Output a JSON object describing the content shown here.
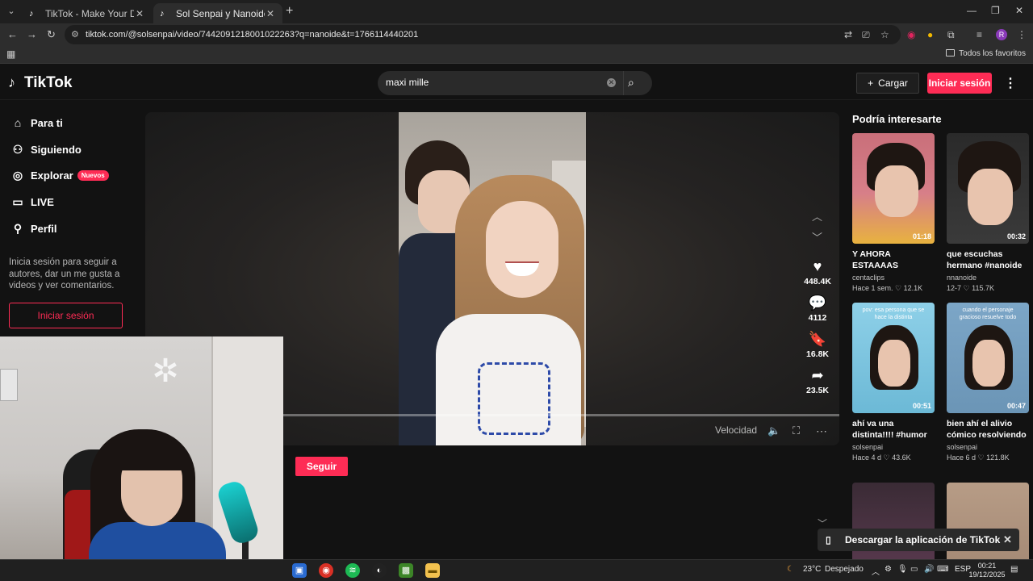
{
  "browser": {
    "tabs": [
      {
        "title": "TikTok - Make Your Day",
        "active": false
      },
      {
        "title": "Sol Senpai y Nanoide: Tutorial",
        "active": true
      }
    ],
    "url": "tiktok.com/@solsenpai/video/7442091218001022263?q=nanoide&t=1766114440201",
    "bookmarks_all": "Todos los favoritos",
    "profile_initial": "R"
  },
  "tiktok": {
    "logo": "TikTok",
    "search": {
      "value": "maxi mille"
    },
    "upload_label": "Cargar",
    "login_label": "Iniciar sesión",
    "nav": [
      {
        "label": "Para ti",
        "icon": "home-icon"
      },
      {
        "label": "Siguiendo",
        "icon": "following-icon"
      },
      {
        "label": "Explorar",
        "icon": "compass-icon",
        "badge": "Nuevos"
      },
      {
        "label": "LIVE",
        "icon": "live-icon"
      },
      {
        "label": "Perfil",
        "icon": "profile-icon"
      }
    ],
    "side_text": "Inicia sesión para seguir a autores, dar un me gusta a videos y ver comentarios.",
    "side_login": "Iniciar sesión",
    "video": {
      "likes": "448.4K",
      "comments": "4112",
      "saves": "16.8K",
      "shares": "23.5K",
      "speed_label": "Velocidad"
    },
    "follow_label": "Seguir",
    "recs_title": "Podría interesarte",
    "recs": [
      {
        "duration": "01:18",
        "title": "Y AHORA ESTAAAAS #nanoide",
        "author": "centaclips",
        "date": "Hace 1 sem.",
        "likes": "12.1K"
      },
      {
        "duration": "00:32",
        "title": "que escuchas hermano #nanoide",
        "author": "nnanoide",
        "date": "12-7",
        "likes": "115.7K"
      },
      {
        "duration": "00:51",
        "title": "ahí va una distinta!!!! #humor #comedia #strangerthings #st...",
        "author": "solsenpai",
        "date": "Hace 4 d",
        "likes": "43.6K",
        "overlay": "pov: esa persona que se hace la distinta"
      },
      {
        "duration": "00:47",
        "title": "bien ahí el alivio cómico resolviendo todo #humor...",
        "author": "solsenpai",
        "date": "Hace 6 d",
        "likes": "121.8K",
        "overlay": "cuando el personaje gracioso resuelve todo"
      }
    ],
    "toast": "Descargar la aplicación de TikTok"
  },
  "taskbar": {
    "weather_temp": "23°C",
    "weather_desc": "Despejado",
    "lang": "ESP",
    "time": "00:21",
    "date": "19/12/2025"
  }
}
